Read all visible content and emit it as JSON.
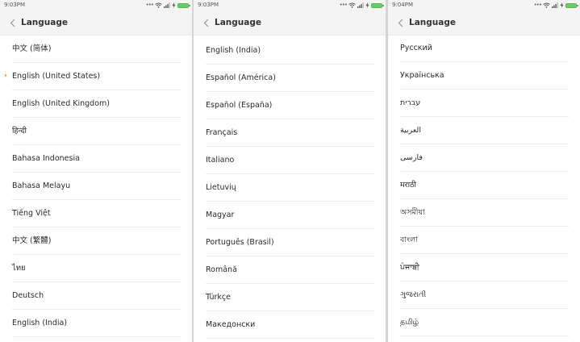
{
  "screens": [
    {
      "time": "9:03PM",
      "title": "Language",
      "items": [
        "中文 (简体)",
        "English (United States)",
        "English (United Kingdom)",
        "हिन्दी",
        "Bahasa Indonesia",
        "Bahasa Melayu",
        "Tiếng Việt",
        "中文 (繁體)",
        "ไทย",
        "Deutsch",
        "English (India)"
      ],
      "selected_index": 1,
      "selected_marker": "›"
    },
    {
      "time": "9:03PM",
      "title": "Language",
      "items": [
        "English (India)",
        "Español (América)",
        "Español (España)",
        "Français",
        "Italiano",
        "Lietuvių",
        "Magyar",
        "Português (Brasil)",
        "Română",
        "Türkçe",
        "Македонски"
      ]
    },
    {
      "time": "9:04PM",
      "title": "Language",
      "items": [
        "Русский",
        "Українська",
        "עברית",
        "العربية",
        "فارسی",
        "मराठी",
        "অসমীয়া",
        "বাংলা",
        "ਪੰਜਾਬੀ",
        "ગુજરાતી",
        "தமிழ்"
      ]
    }
  ],
  "status_icons": [
    "more-dots-icon",
    "wifi-icon",
    "signal-icon",
    "charging-icon",
    "battery-icon"
  ],
  "accent_color": "#f36f21",
  "battery_color": "#6dcb6a"
}
